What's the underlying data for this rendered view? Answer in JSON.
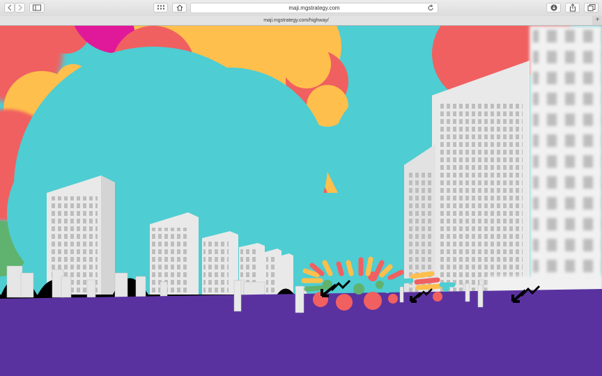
{
  "browser": {
    "address_text": "maji.mgstrategy.com",
    "tab_title": "maji.mgstrategy.com/highway/",
    "new_tab_symbol": "+",
    "icons": [
      "back-icon",
      "forward-icon",
      "sidebar-icon",
      "top-sites-icon",
      "home-icon",
      "reload-icon",
      "download-icon",
      "share-icon",
      "tabs-icon",
      "new-tab-icon"
    ]
  },
  "scene": {
    "colors": {
      "sky": "#4ecdd2",
      "red": "#f06060",
      "orange": "#ffbf4c",
      "magenta": "#e0199a",
      "green": "#5fb36f",
      "ground": "#5a32a0",
      "building": "#e8e8e8",
      "window": "#bdbdbd",
      "arrow": "#000000"
    }
  }
}
